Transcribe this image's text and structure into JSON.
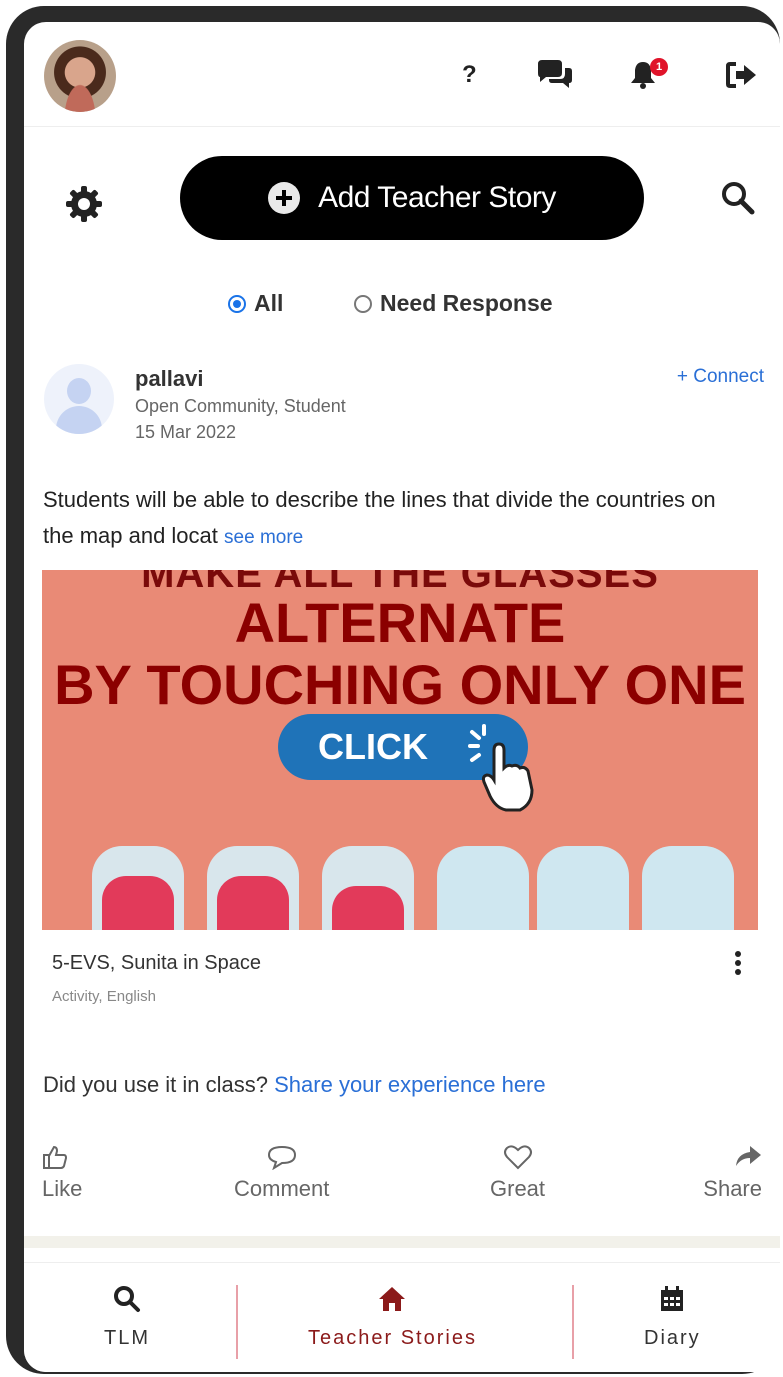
{
  "header": {
    "help_label": "?",
    "notification_count": "1"
  },
  "toolbar": {
    "add_story_label": "Add Teacher Story"
  },
  "filters": {
    "all_label": "All",
    "need_response_label": "Need Response",
    "selected": "All"
  },
  "post": {
    "author": "pallavi",
    "community": "Open Community, Student",
    "date": "15 Mar 2022",
    "connect_label": "+ Connect",
    "text": "Students will be able to describe the lines that divide the countries on the map and locat",
    "see_more_label": "see more",
    "media": {
      "top_partial": "MAKE ALL THE GLASSES",
      "line1": "ALTERNATE",
      "line2": "BY TOUCHING ONLY ONE",
      "click_label": "CLICK"
    },
    "resource_title": "5-EVS, Sunita in Space",
    "resource_tags": "Activity, English",
    "used_prompt": "Did you use it in class?",
    "share_experience_label": "Share your experience here",
    "actions": {
      "like": "Like",
      "comment": "Comment",
      "great": "Great",
      "share": "Share"
    }
  },
  "bottom_nav": {
    "tlm": "TLM",
    "teacher_stories": "Teacher Stories",
    "diary": "Diary",
    "active": "Teacher Stories"
  },
  "colors": {
    "accent_blue": "#2a6fd6",
    "badge_red": "#e0132a",
    "active_nav": "#8b1a1a",
    "media_bg": "#e98a76"
  }
}
